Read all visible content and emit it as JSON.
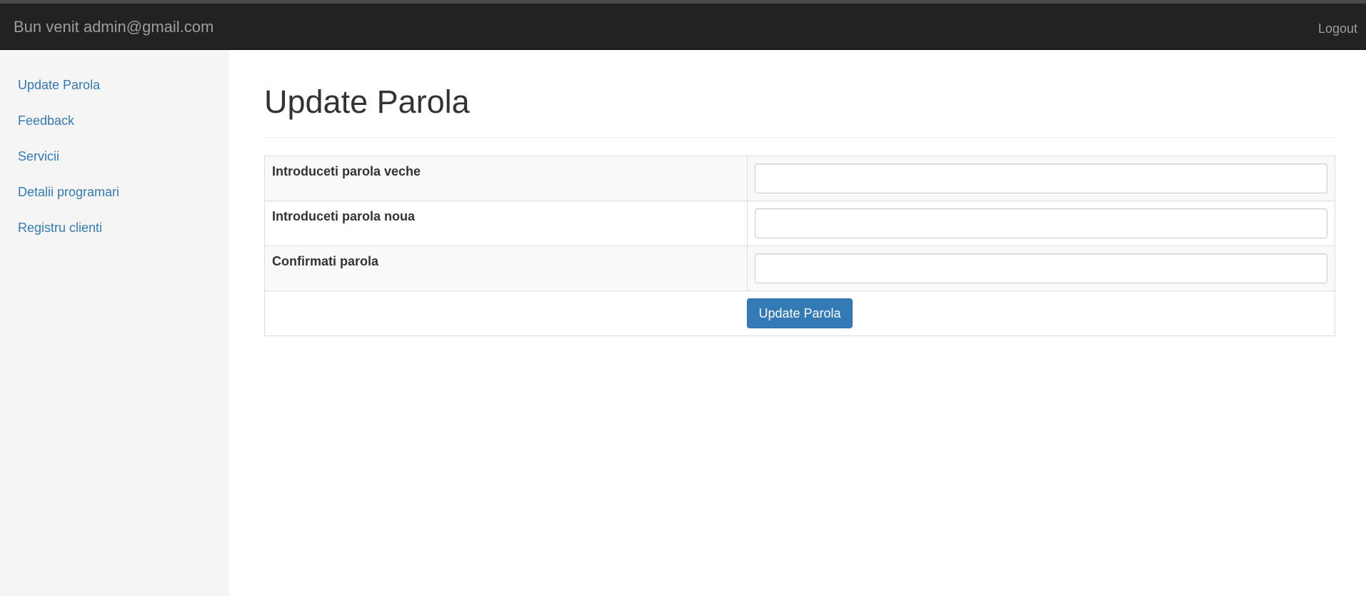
{
  "navbar": {
    "brand": "Bun venit admin@gmail.com",
    "logout": "Logout"
  },
  "sidebar": {
    "items": [
      {
        "label": "Update Parola"
      },
      {
        "label": "Feedback"
      },
      {
        "label": "Servicii"
      },
      {
        "label": "Detalii programari"
      },
      {
        "label": "Registru clienti"
      }
    ]
  },
  "main": {
    "title": "Update Parola",
    "form": {
      "rows": [
        {
          "label": "Introduceti parola veche",
          "value": ""
        },
        {
          "label": "Introduceti parola noua",
          "value": ""
        },
        {
          "label": "Confirmati parola",
          "value": ""
        }
      ],
      "submit_label": "Update Parola"
    }
  },
  "colors": {
    "navbar_bg": "#222222",
    "link": "#337ab7",
    "button": "#337ab7",
    "sidebar_bg": "#f5f5f5"
  }
}
